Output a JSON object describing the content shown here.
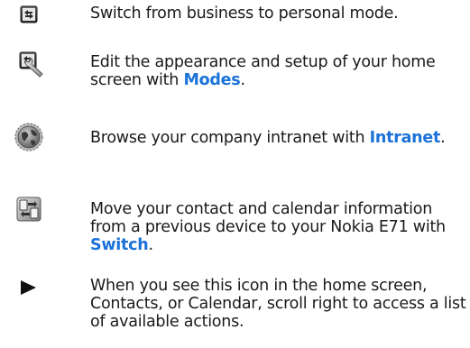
{
  "items": [
    {
      "icon": "mode-switch-icon",
      "text": "Switch from business to personal mode.",
      "link": "",
      "suffix": ""
    },
    {
      "icon": "modes-settings-icon",
      "text": "Edit the appearance and setup of your home screen with ",
      "link": "Modes",
      "suffix": "."
    },
    {
      "icon": "intranet-globe-icon",
      "text": "Browse your company intranet with ",
      "link": "Intranet",
      "suffix": "."
    },
    {
      "icon": "switch-transfer-icon",
      "text": "Move your contact and calendar information from a previous device to your Nokia E71 with ",
      "link": "Switch",
      "suffix": "."
    },
    {
      "icon": "scroll-right-arrow-icon",
      "text": "When you see this icon in the home screen, Contacts, or Calendar, scroll right to access a list of available actions.",
      "link": "",
      "suffix": ""
    }
  ],
  "colors": {
    "link": "#1b73d9",
    "text": "#1a1a1a"
  }
}
